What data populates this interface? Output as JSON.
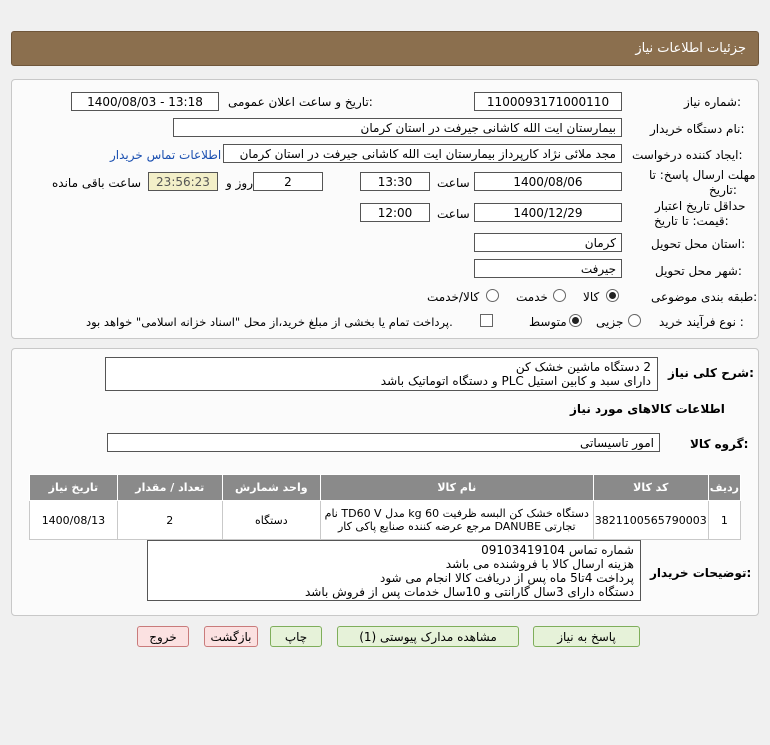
{
  "header": {
    "title": "جزئیات اطلاعات نیاز"
  },
  "form": {
    "need_number_label": "شماره نیاز:",
    "need_number": "1100093171000110",
    "announce_label": "تاریخ و ساعت اعلان عمومی:",
    "announce_value": "1400/08/03 - 13:18",
    "buyer_org_label": "نام دستگاه خریدار:",
    "buyer_org": "بیمارستان ایت الله کاشانی جیرفت در استان کرمان",
    "requester_label": "ایجاد کننده درخواست:",
    "requester": "مجد ملائی نژاد کارپرداز بیمارستان ایت الله کاشانی جیرفت در استان کرمان",
    "contact_link": "اطلاعات تماس خریدار",
    "deadline_label_1": "مهلت ارسال پاسخ: تا",
    "deadline_label_2": "تاریخ:",
    "deadline_date": "1400/08/06",
    "time_label": "ساعت",
    "deadline_time": "13:30",
    "day_label": "روز و",
    "days": "2",
    "remaining_time": "23:56:23",
    "remaining_label": "ساعت باقی مانده",
    "validity_label_1": "حداقل تاریخ اعتبار",
    "validity_label_2": "قیمت: تا تاریخ:",
    "validity_date": "1400/12/29",
    "validity_time_label": "ساعت",
    "validity_time": "12:00",
    "province_label": "استان محل تحویل:",
    "province": "کرمان",
    "city_label": "شهر محل تحویل:",
    "city": "جیرفت",
    "category_label": "طبقه بندی موضوعی:",
    "category_options": [
      "کالا",
      "خدمت",
      "کالا/خدمت"
    ],
    "process_label": "نوع فرآیند خرید :",
    "process_options": [
      "جزیی",
      "متوسط"
    ],
    "treasury_text": "پرداخت تمام یا بخشی از مبلغ خرید،از محل \"اسناد خزانه اسلامی\" خواهد بود."
  },
  "details": {
    "desc_label": "شرح کلی نیاز:",
    "desc_lines": [
      "2 دستگاه ماشین خشک کن",
      "دارای سبد و کابین استیل PLC و دستگاه اتوماتیک باشد"
    ],
    "goods_info_title": "اطلاعات کالاهای مورد نیاز",
    "goods_group_label": "گروه کالا:",
    "goods_group": "امور تاسیساتی",
    "table": {
      "headers": [
        "ردیف",
        "کد کالا",
        "نام کالا",
        "واحد شمارش",
        "تعداد / مقدار",
        "تاریخ نیاز"
      ],
      "rows": [
        {
          "index": "1",
          "code": "3821100565790003",
          "name_line1": "دستگاه خشک کن البسه ظرفیت 60 kg مدل TD60 V نام",
          "name_line2": "تجارتی DANUBE مرجع عرضه کننده صنایع پاکی کار",
          "unit": "دستگاه",
          "qty": "2",
          "date": "1400/08/13"
        }
      ]
    },
    "buyer_notes_label": "توضیحات خریدار:",
    "buyer_notes": [
      "شماره تماس 09103419104",
      "هزینه ارسال کالا با فروشنده می باشد",
      "پرداخت 4تا5 ماه پس از دریافت کالا انجام می شود",
      "دستگاه دارای 3سال گارانتی و 10سال خدمات پس از فروش باشد"
    ]
  },
  "buttons": {
    "reply": "پاسخ به نیاز",
    "attachments": "مشاهده مدارک پیوستی (1)",
    "print": "چاپ",
    "back": "بازگشت",
    "exit": "خروج"
  }
}
